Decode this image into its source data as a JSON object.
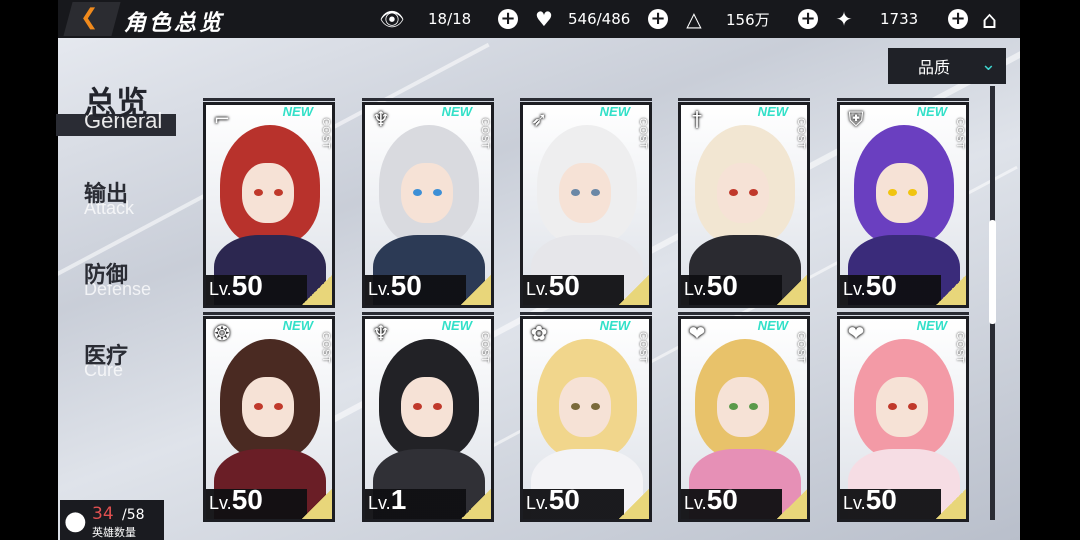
{
  "header": {
    "title": "角色总览",
    "back_icon": "back-arrow-icon",
    "home_icon": "home-icon"
  },
  "resources": [
    {
      "icon": "eye-icon",
      "value": "18/18"
    },
    {
      "icon": "stamina-icon",
      "value": "546/486"
    },
    {
      "icon": "coin-icon",
      "value": "156万"
    },
    {
      "icon": "star-icon",
      "value": "1733"
    }
  ],
  "sidebar": {
    "tabs": [
      {
        "cn": "总览",
        "en": "General",
        "active": true
      },
      {
        "cn": "输出",
        "en": "Attack",
        "active": false
      },
      {
        "cn": "防御",
        "en": "Defense",
        "active": false
      },
      {
        "cn": "医疗",
        "en": "Cure",
        "active": false
      }
    ]
  },
  "filter": {
    "label": "品质"
  },
  "cards": [
    {
      "class_icon": "gun-icon",
      "new": "NEW",
      "cost": "COST",
      "lv_prefix": "Lv.",
      "level": "50",
      "hair": "#b8322c",
      "eye": "#c0392b",
      "outfit": "#2c2750"
    },
    {
      "class_icon": "demon-mask-icon",
      "new": "NEW",
      "cost": "COST",
      "lv_prefix": "Lv.",
      "level": "50",
      "hair": "#d9dadf",
      "eye": "#3d8fd6",
      "outfit": "#2c3a55"
    },
    {
      "class_icon": "bow-icon",
      "new": "NEW",
      "cost": "COST",
      "lv_prefix": "Lv.",
      "level": "50",
      "hair": "#eeeeef",
      "eye": "#6b88a6",
      "outfit": "#e6e6ea"
    },
    {
      "class_icon": "sword-icon",
      "new": "NEW",
      "cost": "COST",
      "lv_prefix": "Lv.",
      "level": "50",
      "hair": "#f2e6d2",
      "eye": "#c0392b",
      "outfit": "#2a2a30"
    },
    {
      "class_icon": "shield-icon",
      "new": "NEW",
      "cost": "COST",
      "lv_prefix": "Lv.",
      "level": "50",
      "hair": "#6a3fc0",
      "eye": "#f1c40f",
      "outfit": "#3a2b7a"
    },
    {
      "class_icon": "winged-emblem-icon",
      "new": "NEW",
      "cost": "COST",
      "lv_prefix": "Lv.",
      "level": "50",
      "hair": "#4a2a22",
      "eye": "#c0392b",
      "outfit": "#6a1e26"
    },
    {
      "class_icon": "demon-mask-icon",
      "new": "NEW",
      "cost": "COST",
      "lv_prefix": "Lv.",
      "level": "1",
      "hair": "#222226",
      "eye": "#c0392b",
      "outfit": "#303036"
    },
    {
      "class_icon": "flower-icon",
      "new": "NEW",
      "cost": "COST",
      "lv_prefix": "Lv.",
      "level": "50",
      "hair": "#f1d68c",
      "eye": "#7a6a3a",
      "outfit": "#f3f3f6"
    },
    {
      "class_icon": "heart-icon",
      "new": "NEW",
      "cost": "COST",
      "lv_prefix": "Lv.",
      "level": "50",
      "hair": "#e8c26a",
      "eye": "#5a9a4a",
      "outfit": "#e690b6"
    },
    {
      "class_icon": "heart-icon",
      "new": "NEW",
      "cost": "COST",
      "lv_prefix": "Lv.",
      "level": "50",
      "hair": "#f39aa6",
      "eye": "#c0392b",
      "outfit": "#f6dde4"
    }
  ],
  "hero_count": {
    "current": "34",
    "max": "/58",
    "label": "英雄数量"
  },
  "colors": {
    "accent": "#3fd6d0",
    "back_arrow": "#f08a1c",
    "topbar": "#17181c",
    "new_badge": "#32e0c8",
    "corner": "#e8d67a"
  }
}
